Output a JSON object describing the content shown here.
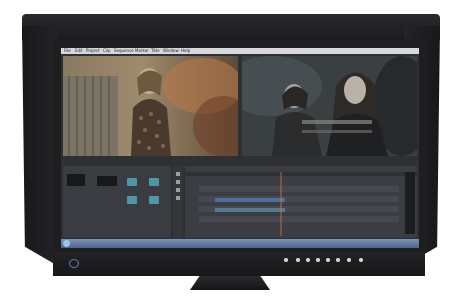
{
  "scene": {
    "subject": "computer monitor with shading hood displaying video editing software",
    "colors": {
      "hood": "#1e1e20",
      "ui_background": "#3a3c41",
      "clip_bar": "#4b6fa0",
      "playhead": "#e0783a",
      "taskbar": "#5b72a0",
      "accent_icon": "#4e97a8"
    }
  },
  "software": {
    "menus": [
      "File",
      "Edit",
      "Project",
      "Clip",
      "Sequence",
      "Marker",
      "Title",
      "Window",
      "Help"
    ],
    "panels": [
      "source-monitor",
      "program-monitor",
      "project-panel",
      "tools-panel",
      "timeline",
      "audio-meters"
    ]
  },
  "monitor": {
    "controls": [
      "power",
      "mode",
      "input",
      "down",
      "up",
      "enter",
      "menu",
      "sig"
    ],
    "logo_icon": "circle-logo-icon"
  }
}
